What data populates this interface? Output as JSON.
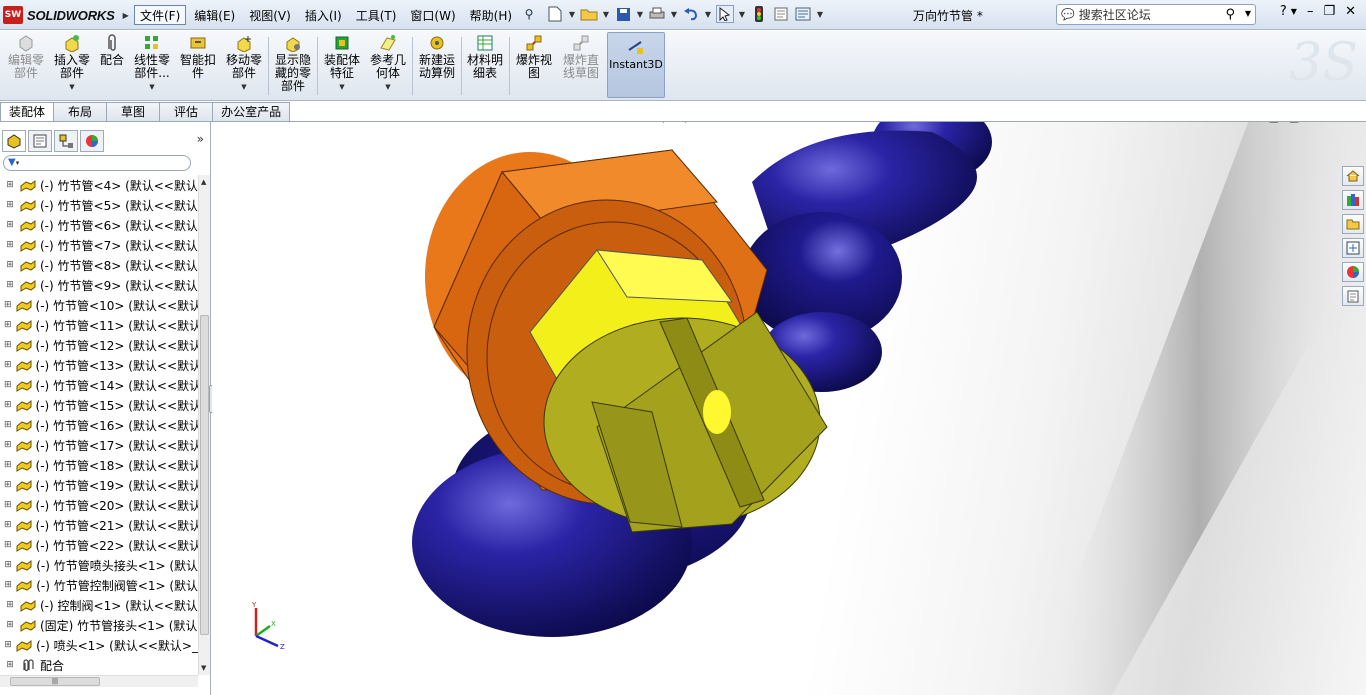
{
  "app": {
    "logo_badge": "SW",
    "logo_text": "SOLIDWORKS",
    "doc_title": "万向竹节管 *"
  },
  "menu": [
    "文件(F)",
    "编辑(E)",
    "视图(V)",
    "插入(I)",
    "工具(T)",
    "窗口(W)",
    "帮助(H)"
  ],
  "search": {
    "placeholder": "搜索社区论坛"
  },
  "commands": [
    {
      "label": "编辑零\n部件",
      "enabled": false
    },
    {
      "label": "插入零\n部件",
      "enabled": true
    },
    {
      "label": "配合",
      "enabled": true
    },
    {
      "label": "线性零\n部件...",
      "enabled": true
    },
    {
      "label": "智能扣\n件",
      "enabled": true
    },
    {
      "label": "移动零\n部件",
      "enabled": true
    },
    {
      "label": "显示隐\n藏的零\n部件",
      "enabled": true
    },
    {
      "label": "装配体\n特征",
      "enabled": true
    },
    {
      "label": "参考几\n何体",
      "enabled": true
    },
    {
      "label": "新建运\n动算例",
      "enabled": true
    },
    {
      "label": "材料明\n细表",
      "enabled": true
    },
    {
      "label": "爆炸视\n图",
      "enabled": true
    },
    {
      "label": "爆炸直\n线草图",
      "enabled": false
    },
    {
      "label": "Instant3D",
      "enabled": true
    }
  ],
  "tabs": [
    "装配体",
    "布局",
    "草图",
    "评估",
    "办公室产品"
  ],
  "tree": [
    "(-) 竹节管<4> (默认<<默认",
    "(-) 竹节管<5> (默认<<默认",
    "(-) 竹节管<6> (默认<<默认",
    "(-) 竹节管<7> (默认<<默认",
    "(-) 竹节管<8> (默认<<默认",
    "(-) 竹节管<9> (默认<<默认",
    "(-) 竹节管<10> (默认<<默认",
    "(-) 竹节管<11> (默认<<默认",
    "(-) 竹节管<12> (默认<<默认",
    "(-) 竹节管<13> (默认<<默认",
    "(-) 竹节管<14> (默认<<默认",
    "(-) 竹节管<15> (默认<<默认",
    "(-) 竹节管<16> (默认<<默认",
    "(-) 竹节管<17> (默认<<默认",
    "(-) 竹节管<18> (默认<<默认",
    "(-) 竹节管<19> (默认<<默认",
    "(-) 竹节管<20> (默认<<默认",
    "(-) 竹节管<21> (默认<<默认",
    "(-) 竹节管<22> (默认<<默认",
    "(-) 竹节管喷头接头<1> (默认",
    "(-) 竹节管控制阀管<1> (默认",
    "(-) 控制阀<1> (默认<<默认",
    "(固定) 竹节管接头<1> (默认",
    "(-) 喷头<1> (默认<<默认>_",
    "配合"
  ],
  "triad": {
    "x": "X",
    "y": "Y",
    "z": "Z"
  },
  "colors": {
    "orange": "#e8781a",
    "navy": "#17127a",
    "yellow": "#f0ee1e",
    "olive": "#9a9a18"
  }
}
